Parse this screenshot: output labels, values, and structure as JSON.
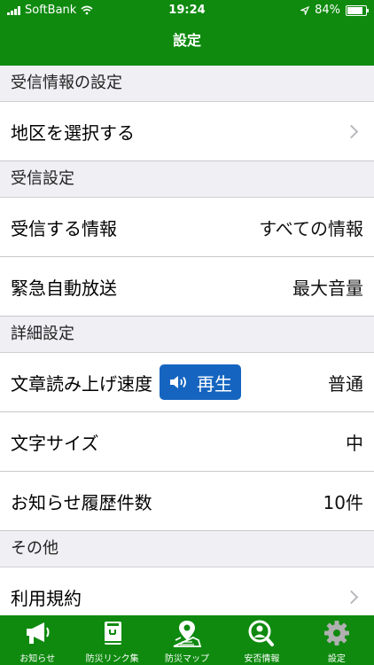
{
  "status_bar": {
    "carrier": "SoftBank",
    "time": "19:24",
    "battery": "84%",
    "battery_level": 0.84,
    "icons": [
      "signal-icon",
      "wifi-icon",
      "location-arrow-icon",
      "battery-icon"
    ]
  },
  "nav": {
    "title": "設定"
  },
  "sections": {
    "reception_info": {
      "header": "受信情報の設定",
      "select_area": "地区を選択する"
    },
    "reception": {
      "header": "受信設定",
      "info_label": "受信する情報",
      "info_value": "すべての情報",
      "broadcast_label": "緊急自動放送",
      "broadcast_value": "最大音量"
    },
    "detail": {
      "header": "詳細設定",
      "speed_label": "文章読み上げ速度",
      "play_label": "再生",
      "speed_value": "普通",
      "font_label": "文字サイズ",
      "font_value": "中",
      "history_label": "お知らせ履歴件数",
      "history_value": "10件"
    },
    "other": {
      "header": "その他",
      "terms_label": "利用規約"
    }
  },
  "tabs": [
    {
      "label": "お知らせ",
      "icon": "megaphone-icon"
    },
    {
      "label": "防災リンク集",
      "icon": "book-icon"
    },
    {
      "label": "防災マップ",
      "icon": "map-pin-icon"
    },
    {
      "label": "安否情報",
      "icon": "person-search-icon"
    },
    {
      "label": "設定",
      "icon": "gear-icon"
    }
  ],
  "colors": {
    "brand_green": "#0f8a0f",
    "play_button_blue": "#1565c0",
    "active_tab": "#b0b0b0"
  }
}
